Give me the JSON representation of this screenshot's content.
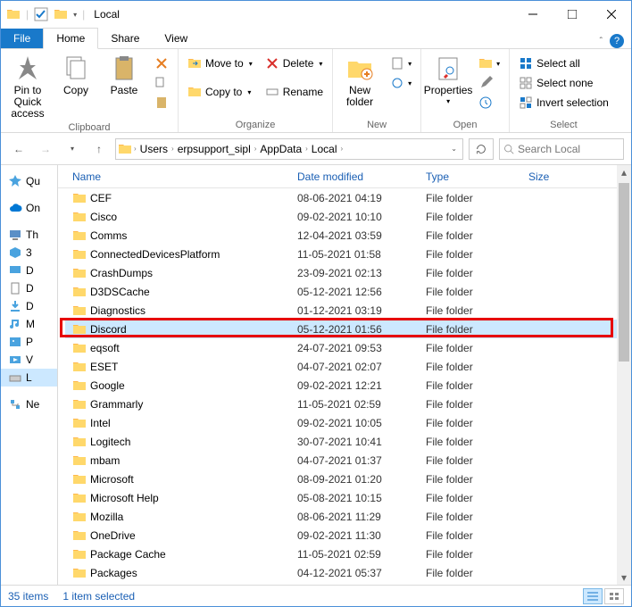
{
  "window": {
    "title": "Local"
  },
  "tabs": {
    "file": "File",
    "home": "Home",
    "share": "Share",
    "view": "View"
  },
  "ribbon": {
    "clipboard": {
      "label": "Clipboard",
      "pin": "Pin to Quick\naccess",
      "copy": "Copy",
      "paste": "Paste"
    },
    "organize": {
      "label": "Organize",
      "moveto": "Move to",
      "copyto": "Copy to",
      "delete": "Delete",
      "rename": "Rename"
    },
    "new": {
      "label": "New",
      "newfolder": "New\nfolder"
    },
    "open": {
      "label": "Open",
      "properties": "Properties"
    },
    "select": {
      "label": "Select",
      "all": "Select all",
      "none": "Select none",
      "invert": "Invert selection"
    }
  },
  "breadcrumbs": [
    "Users",
    "erpsupport_sipl",
    "AppData",
    "Local"
  ],
  "search": {
    "placeholder": "Search Local"
  },
  "columns": {
    "name": "Name",
    "date": "Date modified",
    "type": "Type",
    "size": "Size"
  },
  "nav": [
    {
      "text": "Qu",
      "icon": "star",
      "color": "#4aa3df"
    },
    {
      "text": "On",
      "icon": "cloud",
      "color": "#0078d4"
    },
    {
      "text": "Th",
      "icon": "pc",
      "color": "#5a8fc7"
    },
    {
      "text": "3",
      "icon": "obj",
      "color": "#4aa3df"
    },
    {
      "text": "D",
      "icon": "desk",
      "color": "#4aa3df"
    },
    {
      "text": "D",
      "icon": "doc",
      "color": "#888"
    },
    {
      "text": "D",
      "icon": "dl",
      "color": "#4aa3df"
    },
    {
      "text": "M",
      "icon": "music",
      "color": "#4aa3df"
    },
    {
      "text": "P",
      "icon": "pic",
      "color": "#4aa3df"
    },
    {
      "text": "V",
      "icon": "vid",
      "color": "#4aa3df"
    },
    {
      "text": "L",
      "icon": "drive",
      "color": "#888",
      "sel": true
    },
    {
      "text": "Ne",
      "icon": "net",
      "color": "#4aa3df"
    }
  ],
  "items": [
    {
      "name": "CEF",
      "date": "08-06-2021 04:19",
      "type": "File folder"
    },
    {
      "name": "Cisco",
      "date": "09-02-2021 10:10",
      "type": "File folder"
    },
    {
      "name": "Comms",
      "date": "12-04-2021 03:59",
      "type": "File folder"
    },
    {
      "name": "ConnectedDevicesPlatform",
      "date": "11-05-2021 01:58",
      "type": "File folder"
    },
    {
      "name": "CrashDumps",
      "date": "23-09-2021 02:13",
      "type": "File folder"
    },
    {
      "name": "D3DSCache",
      "date": "05-12-2021 12:56",
      "type": "File folder"
    },
    {
      "name": "Diagnostics",
      "date": "01-12-2021 03:19",
      "type": "File folder"
    },
    {
      "name": "Discord",
      "date": "05-12-2021 01:56",
      "type": "File folder",
      "sel": true,
      "hl": true
    },
    {
      "name": "eqsoft",
      "date": "24-07-2021 09:53",
      "type": "File folder"
    },
    {
      "name": "ESET",
      "date": "04-07-2021 02:07",
      "type": "File folder"
    },
    {
      "name": "Google",
      "date": "09-02-2021 12:21",
      "type": "File folder"
    },
    {
      "name": "Grammarly",
      "date": "11-05-2021 02:59",
      "type": "File folder"
    },
    {
      "name": "Intel",
      "date": "09-02-2021 10:05",
      "type": "File folder"
    },
    {
      "name": "Logitech",
      "date": "30-07-2021 10:41",
      "type": "File folder"
    },
    {
      "name": "mbam",
      "date": "04-07-2021 01:37",
      "type": "File folder"
    },
    {
      "name": "Microsoft",
      "date": "08-09-2021 01:20",
      "type": "File folder"
    },
    {
      "name": "Microsoft Help",
      "date": "05-08-2021 10:15",
      "type": "File folder"
    },
    {
      "name": "Mozilla",
      "date": "08-06-2021 11:29",
      "type": "File folder"
    },
    {
      "name": "OneDrive",
      "date": "09-02-2021 11:30",
      "type": "File folder"
    },
    {
      "name": "Package Cache",
      "date": "11-05-2021 02:59",
      "type": "File folder"
    },
    {
      "name": "Packages",
      "date": "04-12-2021 05:37",
      "type": "File folder"
    }
  ],
  "status": {
    "count": "35 items",
    "selected": "1 item selected"
  }
}
